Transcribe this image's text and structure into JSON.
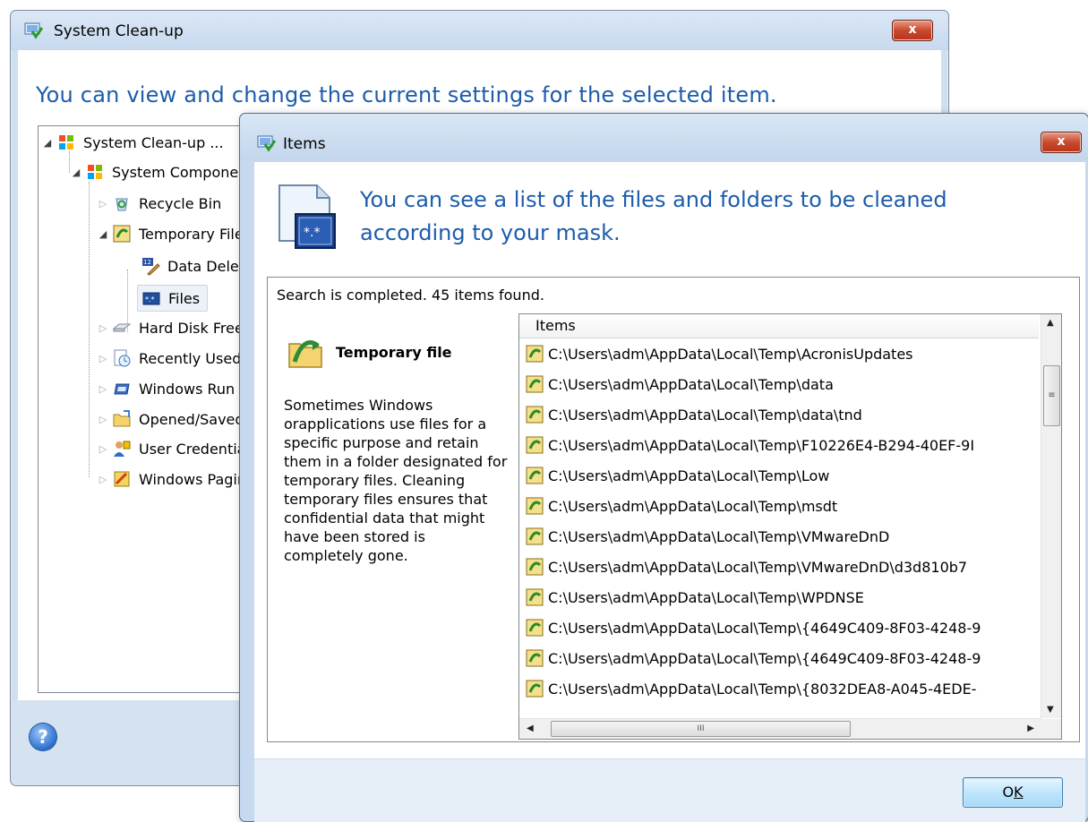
{
  "main_window": {
    "title": "System Clean-up",
    "close_label": "x",
    "header": "You can view and change the current settings for the selected item.",
    "help_label": "?",
    "tree": [
      {
        "label": "System Clean-up ...",
        "level": 0,
        "expanded": true,
        "icon": "windows-logo-icon"
      },
      {
        "label": "System Components",
        "level": 1,
        "expanded": true,
        "icon": "windows-logo-icon"
      },
      {
        "label": "Recycle Bin",
        "level": 2,
        "expanded": false,
        "icon": "recycle-bin-icon"
      },
      {
        "label": "Temporary Files",
        "level": 2,
        "expanded": true,
        "icon": "temp-files-icon"
      },
      {
        "label": "Data Deletion Method",
        "level": 3,
        "icon": "data-method-icon"
      },
      {
        "label": "Files",
        "level": 3,
        "selected": true,
        "icon": "files-mask-icon"
      },
      {
        "label": "Hard Disk Free Space",
        "level": 2,
        "expanded": false,
        "icon": "hard-disk-icon"
      },
      {
        "label": "Recently Used Documents",
        "level": 2,
        "expanded": false,
        "icon": "recent-docs-icon"
      },
      {
        "label": "Windows Run List",
        "level": 2,
        "expanded": false,
        "icon": "run-list-icon"
      },
      {
        "label": "Opened/Saved Files",
        "level": 2,
        "expanded": false,
        "icon": "folder-icon"
      },
      {
        "label": "User Credentials",
        "level": 2,
        "expanded": false,
        "icon": "user-credentials-icon"
      },
      {
        "label": "Windows Paging File",
        "level": 2,
        "expanded": false,
        "icon": "paging-file-icon"
      }
    ]
  },
  "items_dialog": {
    "title": "Items",
    "close_label": "x",
    "header_line1": "You can see a list of the files and folders to be cleaned",
    "header_line2": "according to your mask.",
    "status": "Search is completed. 45 items found.",
    "type_name": "Temporary file",
    "type_description": "Sometimes Windows orapplications use files for a specific purpose and retain them in a folder designated for temporary files. Cleaning temporary files ensures that confidential data that might have been stored is completely gone.",
    "list_header": "Items",
    "items": [
      "C:\\Users\\adm\\AppData\\Local\\Temp\\AcronisUpdates",
      "C:\\Users\\adm\\AppData\\Local\\Temp\\data",
      "C:\\Users\\adm\\AppData\\Local\\Temp\\data\\tnd",
      "C:\\Users\\adm\\AppData\\Local\\Temp\\F10226E4-B294-40EF-9I",
      "C:\\Users\\adm\\AppData\\Local\\Temp\\Low",
      "C:\\Users\\adm\\AppData\\Local\\Temp\\msdt",
      "C:\\Users\\adm\\AppData\\Local\\Temp\\VMwareDnD",
      "C:\\Users\\adm\\AppData\\Local\\Temp\\VMwareDnD\\d3d810b7",
      "C:\\Users\\adm\\AppData\\Local\\Temp\\WPDNSE",
      "C:\\Users\\adm\\AppData\\Local\\Temp\\{4649C409-8F03-4248-9",
      "C:\\Users\\adm\\AppData\\Local\\Temp\\{4649C409-8F03-4248-9",
      "C:\\Users\\adm\\AppData\\Local\\Temp\\{8032DEA8-A045-4EDE-"
    ],
    "hscroll_grip": "III",
    "vscroll_grip": "≡",
    "ok_label": "OK"
  },
  "colors": {
    "header_text": "#1c5cab",
    "window_frame": "#c6d9ee",
    "close_button": "#c94a2e"
  }
}
